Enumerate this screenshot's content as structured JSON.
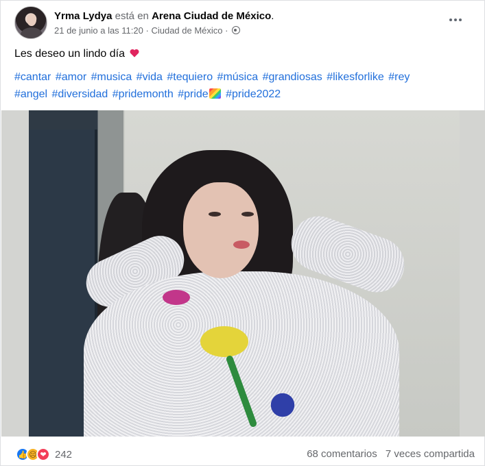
{
  "post": {
    "author": "Yrma Lydya",
    "verb": "está en",
    "place": "Arena Ciudad de México",
    "period": ".",
    "date": "21 de junio a las 11:20",
    "separator1": "·",
    "location": "Ciudad de México",
    "separator2": "·",
    "privacy_icon": "globe-icon",
    "message": "Les deseo un lindo día",
    "message_emoji": "heart-icon",
    "hashtags_line1": [
      "#cantar",
      "#amor",
      "#musica",
      "#vida",
      "#tequiero",
      "#música",
      "#grandiosas",
      "#likesforlike",
      "#rey"
    ],
    "hashtags_line2_before": [
      "#angel",
      "#diversidad",
      "#pridemonth",
      "#pride"
    ],
    "hashtags_line2_after": [
      "#pride2022"
    ],
    "rainbow_emoji": "rainbow-flag-icon"
  },
  "footer": {
    "reactions": [
      "like-icon",
      "sad-icon",
      "love-icon"
    ],
    "reaction_count": "242",
    "comments": "68 comentarios",
    "shares": "7 veces compartida"
  },
  "colors": {
    "link": "#216fdb",
    "secondary_text": "#65676b",
    "like": "#1877f2",
    "love": "#f33e58",
    "sad": "#f7b125"
  }
}
